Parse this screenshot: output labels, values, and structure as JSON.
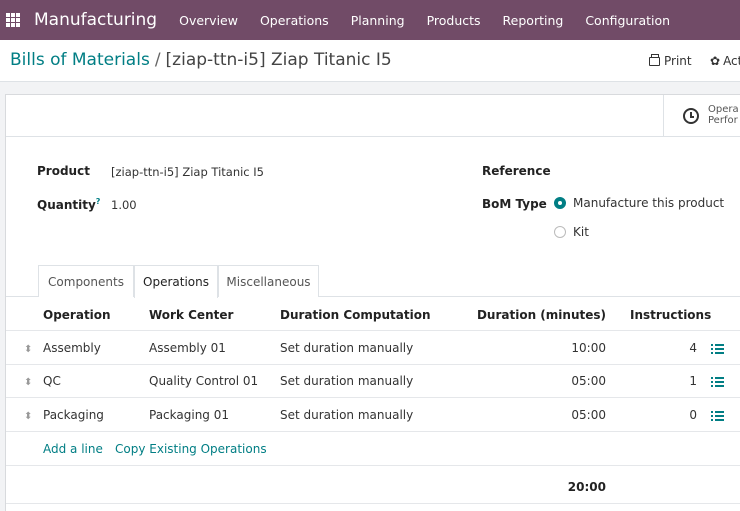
{
  "nav": {
    "app_title": "Manufacturing",
    "items": [
      "Overview",
      "Operations",
      "Planning",
      "Products",
      "Reporting",
      "Configuration"
    ]
  },
  "breadcrumb": {
    "parent": "Bills of Materials",
    "separator": "/",
    "current": "[ziap-ttn-i5] Ziap Titanic I5"
  },
  "toolbar": {
    "print_label": "Print",
    "action_label": "Action"
  },
  "smart_button": {
    "line1": "Opera",
    "line2": "Perfor"
  },
  "form": {
    "product_label": "Product",
    "product_value": "[ziap-ttn-i5] Ziap Titanic I5",
    "quantity_label": "Quantity",
    "quantity_help": "?",
    "quantity_value": "1.00",
    "reference_label": "Reference",
    "bom_type_label": "BoM Type",
    "bom_type_options": [
      "Manufacture this product",
      "Kit"
    ],
    "bom_type_selected": "Manufacture this product"
  },
  "tabs": [
    "Components",
    "Operations",
    "Miscellaneous"
  ],
  "active_tab": "Operations",
  "table": {
    "headers": [
      "Operation",
      "Work Center",
      "Duration Computation",
      "Duration (minutes)",
      "Instructions"
    ],
    "rows": [
      {
        "operation": "Assembly",
        "work_center": "Assembly 01",
        "computation": "Set duration manually",
        "duration": "10:00",
        "instructions": "4"
      },
      {
        "operation": "QC",
        "work_center": "Quality Control 01",
        "computation": "Set duration manually",
        "duration": "05:00",
        "instructions": "1"
      },
      {
        "operation": "Packaging",
        "work_center": "Packaging 01",
        "computation": "Set duration manually",
        "duration": "05:00",
        "instructions": "0"
      }
    ],
    "add_line": "Add a line",
    "copy_existing": "Copy Existing Operations",
    "total_duration": "20:00"
  },
  "colors": {
    "brand": "#714b67",
    "accent": "#017e84"
  }
}
